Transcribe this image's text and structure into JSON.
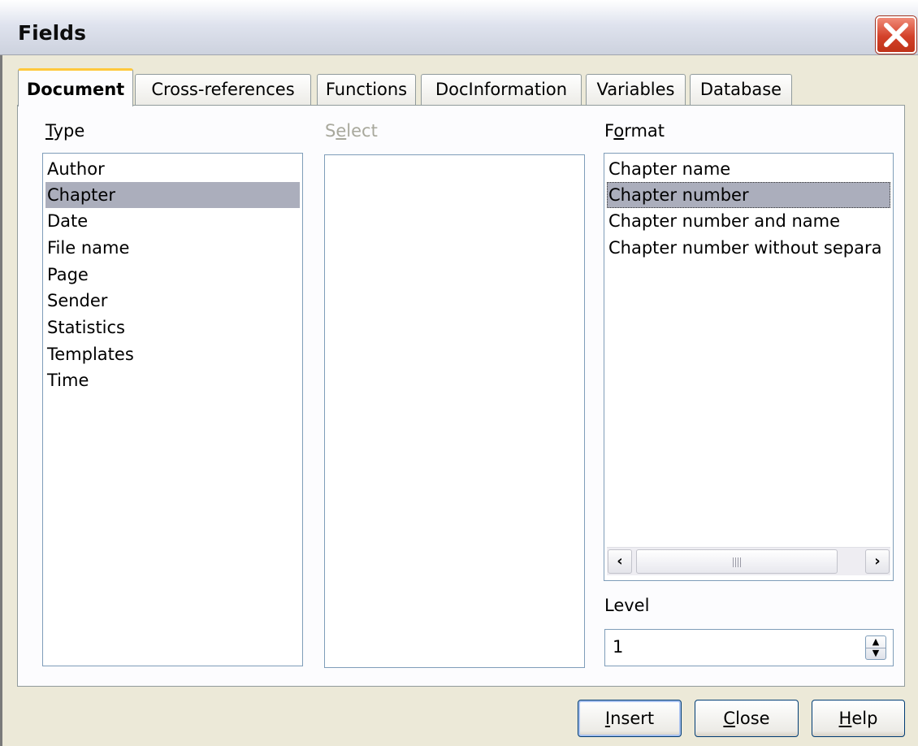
{
  "window": {
    "title": "Fields"
  },
  "tabs": [
    {
      "label": "Document",
      "active": true
    },
    {
      "label": "Cross-references"
    },
    {
      "label": "Functions"
    },
    {
      "label": "DocInformation"
    },
    {
      "label": "Variables"
    },
    {
      "label": "Database"
    }
  ],
  "type": {
    "label_hotkey": "T",
    "label_rest": "ype",
    "items": [
      "Author",
      "Chapter",
      "Date",
      "File name",
      "Page",
      "Sender",
      "Statistics",
      "Templates",
      "Time"
    ],
    "selected": "Chapter"
  },
  "select": {
    "label_pre": "S",
    "label_hotkey": "e",
    "label_rest": "lect",
    "enabled": false
  },
  "format": {
    "label_pre": "F",
    "label_hotkey": "o",
    "label_rest": "rmat",
    "items": [
      "Chapter name",
      "Chapter number",
      "Chapter number and name",
      "Chapter number without separa"
    ],
    "selected": "Chapter number"
  },
  "level": {
    "label": "Level",
    "value": "1"
  },
  "buttons": {
    "insert_hotkey": "I",
    "insert_rest": "nsert",
    "close_hotkey": "C",
    "close_rest": "lose",
    "help_hotkey": "H",
    "help_rest": "elp"
  },
  "icons": {
    "close": "close-icon",
    "scroll_left": "chevron-left-icon",
    "scroll_right": "chevron-right-icon",
    "spin_up": "triangle-up-icon",
    "spin_down": "triangle-down-icon"
  },
  "colors": {
    "selection": "#abaebc",
    "tab_highlight": "#ffc83c",
    "close_button": "#d3412a",
    "dialog_bg": "#ece9d8"
  }
}
